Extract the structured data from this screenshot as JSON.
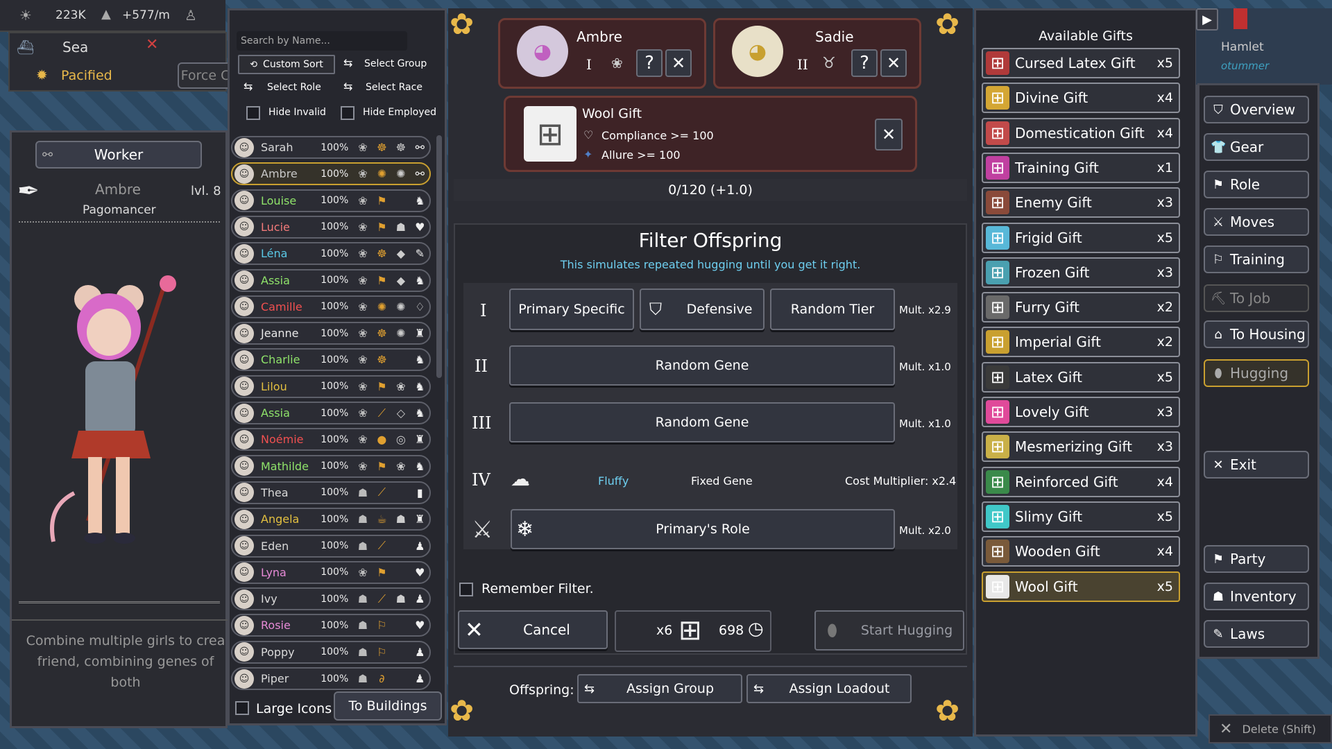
{
  "topbar": {
    "population": "223K",
    "rate": "+577/m"
  },
  "location": {
    "name": "Sea",
    "status": "Pacified",
    "force_label": "Force C"
  },
  "character": {
    "role_label": "Worker",
    "name": "Ambre",
    "level": "lvl. 8",
    "class": "Pagomancer",
    "description": "Combine multiple girls to crea friend, combining genes of both"
  },
  "roster": {
    "search_placeholder": "Search by Name...",
    "custom_sort": "Custom Sort",
    "select_group": "Select Group",
    "select_role": "Select Role",
    "select_race": "Select Race",
    "hide_invalid": "Hide Invalid",
    "hide_employed": "Hide Employed",
    "large_icons": "Large Icons",
    "to_buildings": "To Buildings",
    "rows": [
      {
        "name": "Sarah",
        "pct": "100%",
        "color": "#d9d9d9",
        "i1": "❀",
        "i2": "☸",
        "i3": "☸",
        "i4": "⚯"
      },
      {
        "name": "Ambre",
        "pct": "100%",
        "color": "#c8c8c8",
        "i1": "❀",
        "i2": "✺",
        "i3": "✺",
        "i4": "⚯",
        "selected": true
      },
      {
        "name": "Louise",
        "pct": "100%",
        "color": "#8fe36a",
        "i1": "❀",
        "i2": "⚑",
        "i3": "",
        "i4": "♞"
      },
      {
        "name": "Lucie",
        "pct": "100%",
        "color": "#f37a7a",
        "i1": "❀",
        "i2": "⚑",
        "i3": "☗",
        "i4": "♥"
      },
      {
        "name": "Léna",
        "pct": "100%",
        "color": "#5ac8e6",
        "i1": "❀",
        "i2": "☸",
        "i3": "◆",
        "i4": "✎"
      },
      {
        "name": "Assia",
        "pct": "100%",
        "color": "#8fe36a",
        "i1": "❀",
        "i2": "⚑",
        "i3": "◆",
        "i4": "♞"
      },
      {
        "name": "Camille",
        "pct": "100%",
        "color": "#f05050",
        "i1": "❀",
        "i2": "✺",
        "i3": "✺",
        "i4": "♢"
      },
      {
        "name": "Jeanne",
        "pct": "100%",
        "color": "#e8e8e8",
        "i1": "❀",
        "i2": "☸",
        "i3": "✺",
        "i4": "♜"
      },
      {
        "name": "Charlie",
        "pct": "100%",
        "color": "#8fe36a",
        "i1": "❀",
        "i2": "☸",
        "i3": "",
        "i4": "♞"
      },
      {
        "name": "Lilou",
        "pct": "100%",
        "color": "#e3c040",
        "i1": "❀",
        "i2": "⚑",
        "i3": "❀",
        "i4": "♞"
      },
      {
        "name": "Assia",
        "pct": "100%",
        "color": "#8fe36a",
        "i1": "❀",
        "i2": "⟋",
        "i3": "◇",
        "i4": "♞"
      },
      {
        "name": "Noémie",
        "pct": "100%",
        "color": "#f05050",
        "i1": "❀",
        "i2": "●",
        "i3": "◎",
        "i4": "♜"
      },
      {
        "name": "Mathilde",
        "pct": "100%",
        "color": "#8fe36a",
        "i1": "❀",
        "i2": "⚑",
        "i3": "❀",
        "i4": "♞"
      },
      {
        "name": "Thea",
        "pct": "100%",
        "color": "#d9d9d9",
        "i1": "☗",
        "i2": "⟋",
        "i3": "",
        "i4": "▮"
      },
      {
        "name": "Angela",
        "pct": "100%",
        "color": "#e3c040",
        "i1": "☗",
        "i2": "☕",
        "i3": "☗",
        "i4": "♜"
      },
      {
        "name": "Eden",
        "pct": "100%",
        "color": "#d9d9d9",
        "i1": "☗",
        "i2": "⟋",
        "i3": "",
        "i4": "♟"
      },
      {
        "name": "Lyna",
        "pct": "100%",
        "color": "#e68ad6",
        "i1": "❀",
        "i2": "⚑",
        "i3": "",
        "i4": "♥"
      },
      {
        "name": "Ivy",
        "pct": "100%",
        "color": "#d9d9d9",
        "i1": "☗",
        "i2": "⟋",
        "i3": "☗",
        "i4": "♟"
      },
      {
        "name": "Rosie",
        "pct": "100%",
        "color": "#e68ad6",
        "i1": "☗",
        "i2": "⚐",
        "i3": "",
        "i4": "♥"
      },
      {
        "name": "Poppy",
        "pct": "100%",
        "color": "#d9d9d9",
        "i1": "☗",
        "i2": "⚐",
        "i3": "",
        "i4": "♟"
      },
      {
        "name": "Piper",
        "pct": "100%",
        "color": "#d9d9d9",
        "i1": "☗",
        "i2": "∂",
        "i3": "",
        "i4": "♟"
      }
    ]
  },
  "parents": {
    "p1": {
      "name": "Ambre",
      "tier": "I"
    },
    "p2": {
      "name": "Sadie",
      "tier": "II"
    }
  },
  "gift": {
    "name": "Wool Gift",
    "req1": "Compliance >= 100",
    "req2": "Allure >= 100",
    "progress": "0/120 (+1.0)"
  },
  "filter": {
    "title": "Filter Offspring",
    "subtitle": "This simulates repeated hugging until you get it right.",
    "t1": "I",
    "t2": "II",
    "t3": "III",
    "t4": "IV",
    "r1": {
      "a": "Primary Specific",
      "b": "Defensive",
      "c": "Random Tier",
      "mult": "Mult. x2.9"
    },
    "r2": {
      "a": "Random Gene",
      "mult": "Mult. x1.0"
    },
    "r3": {
      "a": "Random Gene",
      "mult": "Mult. x1.0"
    },
    "r4": {
      "gene": "Fluffy",
      "fixed": "Fixed Gene",
      "cost": "Cost Multiplier: x2.4"
    },
    "r5": {
      "a": "Primary's Role",
      "mult": "Mult. x2.0"
    },
    "remember": "Remember Filter.",
    "cancel": "Cancel",
    "gift_count": "x6",
    "time": "698",
    "start": "Start Hugging"
  },
  "offspring": {
    "label": "Offspring:",
    "assign_group": "Assign Group",
    "assign_loadout": "Assign Loadout"
  },
  "gifts": {
    "title": "Available Gifts",
    "items": [
      {
        "name": "Cursed Latex Gift",
        "count": "x5",
        "color": "#b03a3a"
      },
      {
        "name": "Divine Gift",
        "count": "x4",
        "color": "#d4a634"
      },
      {
        "name": "Domestication Gift",
        "count": "x4",
        "color": "#c24a4a"
      },
      {
        "name": "Training Gift",
        "count": "x1",
        "color": "#c040a0"
      },
      {
        "name": "Enemy Gift",
        "count": "x3",
        "color": "#8a4a3a"
      },
      {
        "name": "Frigid Gift",
        "count": "x5",
        "color": "#58b8d8"
      },
      {
        "name": "Frozen Gift",
        "count": "x3",
        "color": "#4aa0b0"
      },
      {
        "name": "Furry Gift",
        "count": "x2",
        "color": "#6a6a6a"
      },
      {
        "name": "Imperial Gift",
        "count": "x2",
        "color": "#c9a030"
      },
      {
        "name": "Latex Gift",
        "count": "x5",
        "color": "#3a3a3a"
      },
      {
        "name": "Lovely Gift",
        "count": "x3",
        "color": "#e04a9a"
      },
      {
        "name": "Mesmerizing Gift",
        "count": "x3",
        "color": "#c9b048"
      },
      {
        "name": "Reinforced Gift",
        "count": "x4",
        "color": "#3a8a4a"
      },
      {
        "name": "Slimy Gift",
        "count": "x5",
        "color": "#40c8c8"
      },
      {
        "name": "Wooden Gift",
        "count": "x4",
        "color": "#7a5a3a"
      },
      {
        "name": "Wool Gift",
        "count": "x5",
        "color": "#e8e8e8",
        "selected": true
      }
    ]
  },
  "town": {
    "name": "Hamlet",
    "sub": "otummer"
  },
  "nav": {
    "overview": "Overview",
    "gear": "Gear",
    "role": "Role",
    "moves": "Moves",
    "training": "Training",
    "to_job": "To Job",
    "to_housing": "To Housing",
    "hugging": "Hugging",
    "exit": "Exit",
    "party": "Party",
    "inventory": "Inventory",
    "laws": "Laws"
  },
  "delete": "Delete (Shift)"
}
